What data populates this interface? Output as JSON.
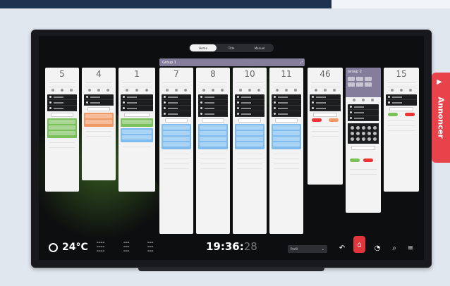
{
  "tabs": [
    {
      "label": "Home",
      "active": true
    },
    {
      "label": "Title",
      "active": false
    },
    {
      "label": "Manuel",
      "active": false
    }
  ],
  "group1": {
    "label": "Group 1"
  },
  "group2": {
    "label": "Group 2"
  },
  "cards": [
    {
      "number": "5",
      "variant": "green"
    },
    {
      "number": "4",
      "variant": "orange"
    },
    {
      "number": "1",
      "variant": "green-blue"
    },
    {
      "number": "7",
      "variant": "blue"
    },
    {
      "number": "8",
      "variant": "blue"
    },
    {
      "number": "10",
      "variant": "blue"
    },
    {
      "number": "11",
      "variant": "blue"
    },
    {
      "number": "46",
      "variant": "plain"
    },
    {
      "number": "15",
      "variant": "plain"
    }
  ],
  "weather": {
    "temperature": "24°C",
    "icon": "sun-icon"
  },
  "clock": {
    "time": "19:36:",
    "seconds": "28"
  },
  "selector": {
    "value": "Profil"
  },
  "controls": [
    "undo-icon",
    "alarm-icon",
    "clock-icon",
    "search-icon",
    "menu-icon"
  ],
  "announce": {
    "label": "Annoncer"
  },
  "colors": {
    "accent": "#e8424a",
    "group": "#857d9c",
    "green": "#7bc15b",
    "orange": "#f09a66",
    "blue": "#7ebcef"
  }
}
